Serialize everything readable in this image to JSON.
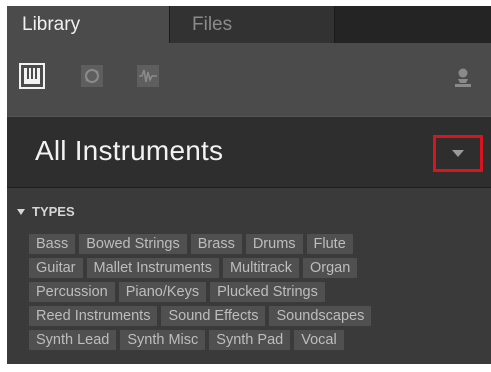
{
  "tabs": [
    {
      "label": "Library"
    },
    {
      "label": "Files"
    }
  ],
  "toolbar": {
    "icons": [
      "instrument-icon",
      "loop-icon",
      "sample-icon",
      "user-icon"
    ]
  },
  "header": {
    "title": "All Instruments"
  },
  "types": {
    "label": "TYPES",
    "rows": [
      [
        "Bass",
        "Bowed Strings",
        "Brass",
        "Drums",
        "Flute"
      ],
      [
        "Guitar",
        "Mallet Instruments",
        "Multitrack",
        "Organ"
      ],
      [
        "Percussion",
        "Piano/Keys",
        "Plucked Strings"
      ],
      [
        "Reed Instruments",
        "Sound Effects",
        "Soundscapes"
      ],
      [
        "Synth Lead",
        "Synth Misc",
        "Synth Pad",
        "Vocal"
      ]
    ]
  },
  "colors": {
    "highlight": "#d8141e",
    "panel": "#3a3a3a",
    "header": "#2e2e2e",
    "tag": "#505050"
  }
}
